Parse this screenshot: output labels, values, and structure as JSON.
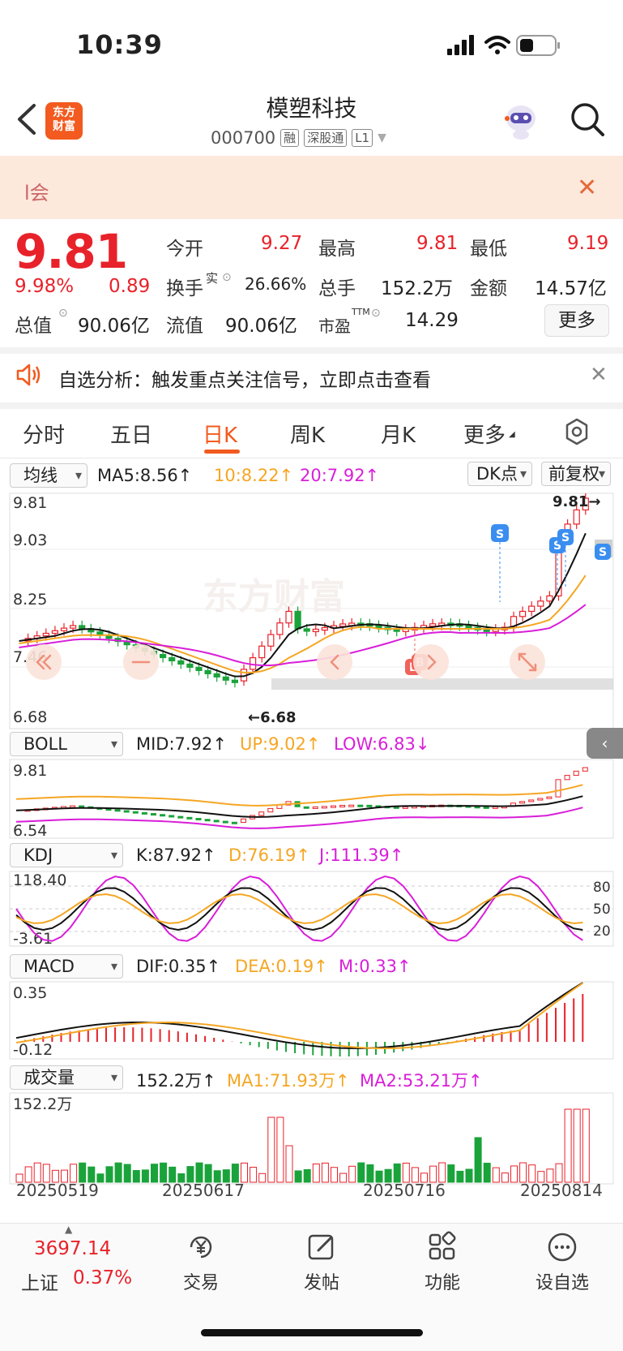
{
  "status_bar": {
    "time": "10:39"
  },
  "header": {
    "logo_line1": "东方",
    "logo_line2": "财富",
    "stock_name": "模塑科技",
    "stock_code": "000700",
    "tags": [
      "融",
      "深股通",
      "L1"
    ]
  },
  "banner": {
    "text": "l会"
  },
  "quote": {
    "price": "9.81",
    "change_pct": "9.98%",
    "change_amt": "0.89",
    "open_label": "今开",
    "open": "9.27",
    "high_label": "最高",
    "high": "9.81",
    "low_label": "最低",
    "low": "9.19",
    "turnover_label": "换手",
    "turnover_sup": "实",
    "turnover": "26.66%",
    "volume_label": "总手",
    "volume": "152.2万",
    "amount_label": "金额",
    "amount": "14.57亿",
    "total_cap_label": "总值",
    "total_cap": "90.06亿",
    "float_cap_label": "流值",
    "float_cap": "90.06亿",
    "pe_label": "市盈",
    "pe_sup": "TTM",
    "pe": "14.29",
    "more_label": "更多"
  },
  "signal": {
    "text": "自选分析：触发重点关注信号，立即点击查看"
  },
  "tabs": [
    "分时",
    "五日",
    "日K",
    "周K",
    "月K",
    "更多"
  ],
  "active_tab": "日K",
  "kline": {
    "selector": "均线",
    "ma5": "MA5:8.56↑",
    "ma10": "10:8.22↑",
    "ma20": "20:7.92↑",
    "dk_label": "DK点",
    "adjust_label": "前复权",
    "y_labels": [
      "9.81",
      "9.03",
      "8.25",
      "7.46",
      "6.68"
    ],
    "max_marker": "9.81→",
    "min_marker": "←6.68",
    "watermark": "东方财富"
  },
  "boll": {
    "selector": "BOLL",
    "mid": "MID:7.92↑",
    "up": "UP:9.02↑",
    "low": "LOW:6.83↓",
    "y_labels": [
      "9.81",
      "6.54"
    ]
  },
  "kdj": {
    "selector": "KDJ",
    "k": "K:87.92↑",
    "d": "D:76.19↑",
    "j": "J:111.39↑",
    "y_labels": [
      "118.40",
      "-3.61"
    ],
    "levels": [
      "80",
      "50",
      "20"
    ]
  },
  "macd": {
    "selector": "MACD",
    "dif": "DIF:0.35↑",
    "dea": "DEA:0.19↑",
    "m": "M:0.33↑",
    "y_labels": [
      "0.35",
      "-0.12"
    ]
  },
  "volume": {
    "selector": "成交量",
    "value": "152.2万↑",
    "ma1": "MA1:71.93万↑",
    "ma2": "MA2:53.21万↑",
    "y_label": "152.2万",
    "dates": [
      "20250519",
      "20250617",
      "20250716",
      "20250814"
    ]
  },
  "bottom_nav": {
    "index_value": "3697.14",
    "index_name": "上证",
    "index_change": "0.37%",
    "items": [
      "交易",
      "发帖",
      "功能",
      "设自选"
    ]
  },
  "colors": {
    "up": "#e8222a",
    "down": "#1aa33a",
    "accent": "#f25a1f",
    "ma10": "#f5a623",
    "ma20": "#d81ed9"
  }
}
